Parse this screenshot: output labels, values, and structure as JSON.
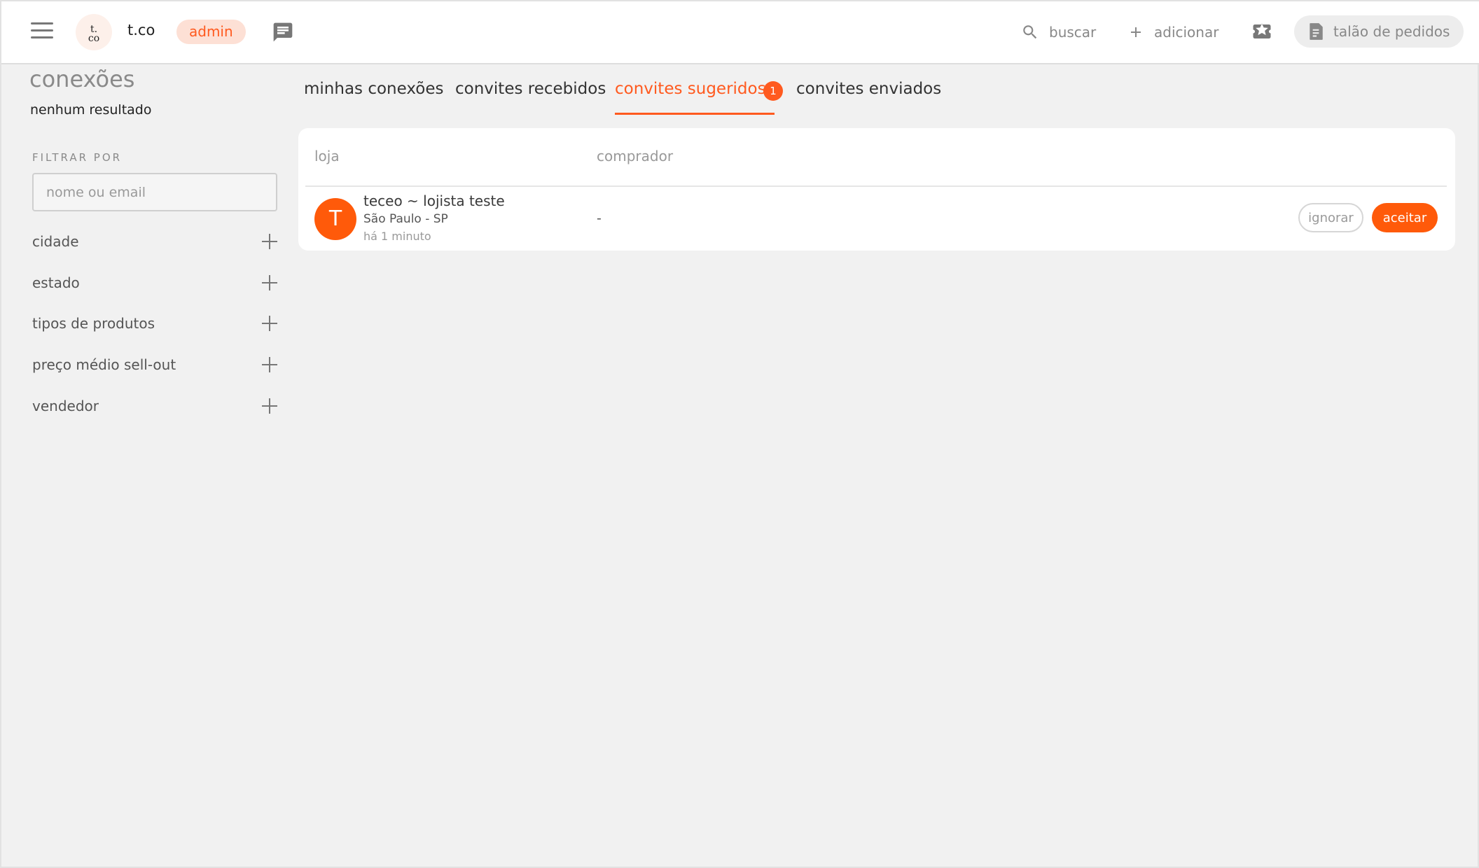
{
  "header": {
    "logo_text_top": "t.",
    "logo_text_bottom": "co",
    "brand": "t.co",
    "role_badge": "admin",
    "search_label": "buscar",
    "add_label": "adicionar",
    "orders_label": "talão de pedidos"
  },
  "sidebar": {
    "title": "conexões",
    "result_text": "nenhum resultado",
    "filter_heading": "FILTRAR POR",
    "filter_placeholder": "nome ou email",
    "filters": [
      {
        "label": "cidade"
      },
      {
        "label": "estado"
      },
      {
        "label": "tipos de produtos"
      },
      {
        "label": "preço médio sell-out"
      },
      {
        "label": "vendedor"
      }
    ]
  },
  "tabs": [
    {
      "label": "minhas conexões"
    },
    {
      "label": "convites recebidos"
    },
    {
      "label": "convites sugeridos",
      "active": true,
      "badge": "1"
    },
    {
      "label": "convites enviados"
    }
  ],
  "table": {
    "columns": [
      "loja",
      "comprador"
    ],
    "rows": [
      {
        "avatar_letter": "T",
        "store_name": "teceo ~ lojista teste",
        "location": "São Paulo - SP",
        "time": "há 1 minuto",
        "buyer": "-",
        "ignore_label": "ignorar",
        "accept_label": "aceitar"
      }
    ]
  },
  "colors": {
    "accent": "#ff5a1f",
    "avatar": "#ff5a0a",
    "background": "#f1f1f1",
    "badge_bg": "#fde0d5"
  },
  "icons": [
    "menu-icon",
    "chat-icon",
    "search-icon",
    "plus-icon",
    "star-ticket-icon",
    "receipt-icon"
  ]
}
